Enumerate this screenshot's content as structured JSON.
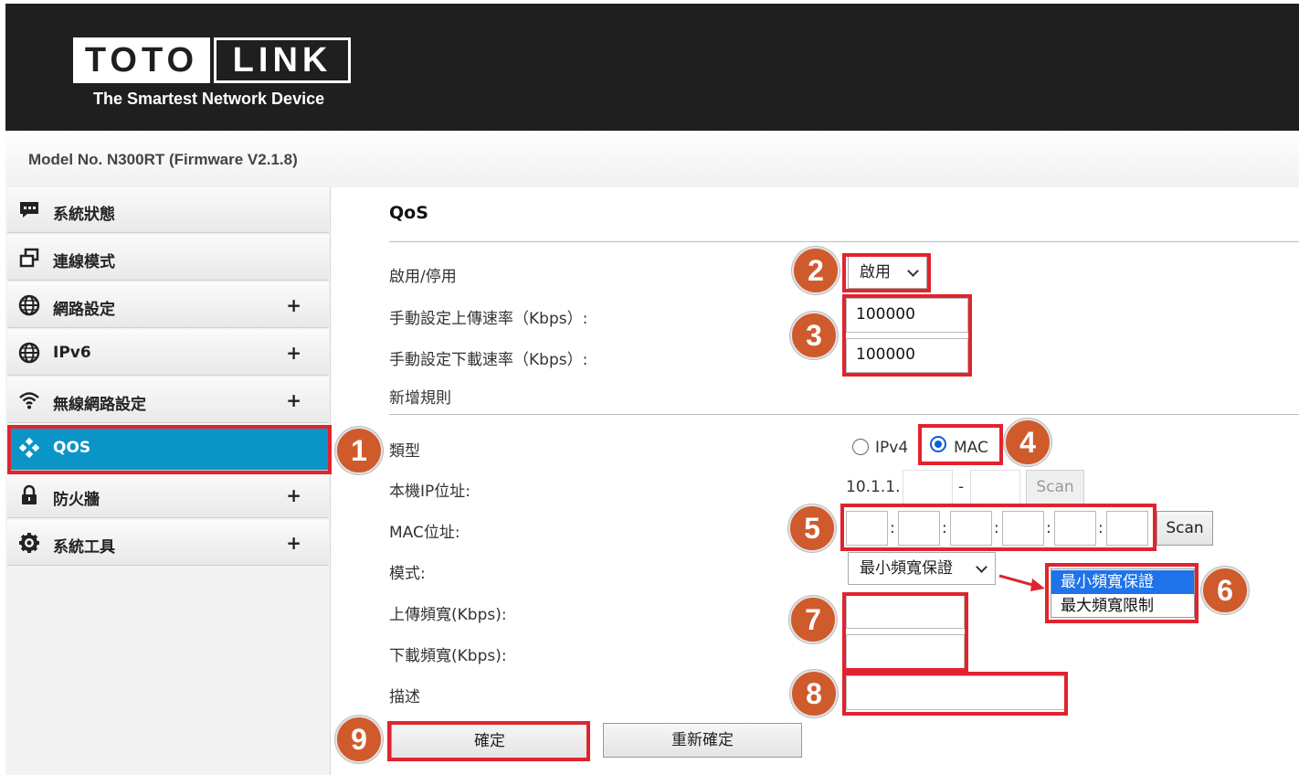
{
  "brand": {
    "logo_left": "TOTO",
    "logo_right": "LINK",
    "tagline": "The Smartest Network Device"
  },
  "model_info": "Model No. N300RT (Firmware V2.1.8)",
  "sidebar": {
    "items": [
      {
        "label": "系統狀態",
        "icon": "status-icon",
        "has_plus": false
      },
      {
        "label": "連線模式",
        "icon": "mode-icon",
        "has_plus": false
      },
      {
        "label": "網路設定",
        "icon": "globe-icon",
        "has_plus": true,
        "plus": "+"
      },
      {
        "label": "IPv6",
        "icon": "globe-icon",
        "has_plus": true,
        "plus": "+"
      },
      {
        "label": "無線網路設定",
        "icon": "wifi-icon",
        "has_plus": true,
        "plus": "+"
      },
      {
        "label": "QOS",
        "icon": "qos-icon",
        "has_plus": false,
        "active": true
      },
      {
        "label": "防火牆",
        "icon": "lock-icon",
        "has_plus": true,
        "plus": "+"
      },
      {
        "label": "系統工具",
        "icon": "gear-icon",
        "has_plus": true,
        "plus": "+"
      }
    ]
  },
  "qos": {
    "title": "QoS",
    "enable_label": "啟用/停用",
    "enable_value": "啟用",
    "upload_rate_label": "手動設定上傳速率（Kbps）:",
    "upload_rate_value": "100000",
    "download_rate_label": "手動設定下載速率（Kbps）:",
    "download_rate_value": "100000",
    "add_rule_title": "新增規則",
    "type_label": "類型",
    "type_options": [
      "IPv4",
      "MAC"
    ],
    "type_selected": "MAC",
    "local_ip_label": "本機IP位址:",
    "local_ip_prefix": "10.1.1.",
    "local_ip_dash": "-",
    "scan_ip_label": "Scan",
    "mac_label": "MAC位址:",
    "mac_sep": ":",
    "scan_mac_label": "Scan",
    "mode_label": "模式:",
    "mode_value": "最小頻寬保證",
    "mode_options": [
      "最小頻寬保證",
      "最大頻寬限制"
    ],
    "upload_bw_label": "上傳頻寬(Kbps):",
    "download_bw_label": "下載頻寬(Kbps):",
    "desc_label": "描述",
    "confirm_label": "確定",
    "reset_label": "重新確定"
  },
  "annotations": {
    "highlight_color": "#e0242e",
    "badge_color": "#cf5a2c",
    "badges": [
      "1",
      "2",
      "3",
      "4",
      "5",
      "6",
      "7",
      "8",
      "9"
    ]
  },
  "colors": {
    "active_nav": "#0b95c7",
    "header_bg": "#1f1f1f"
  }
}
